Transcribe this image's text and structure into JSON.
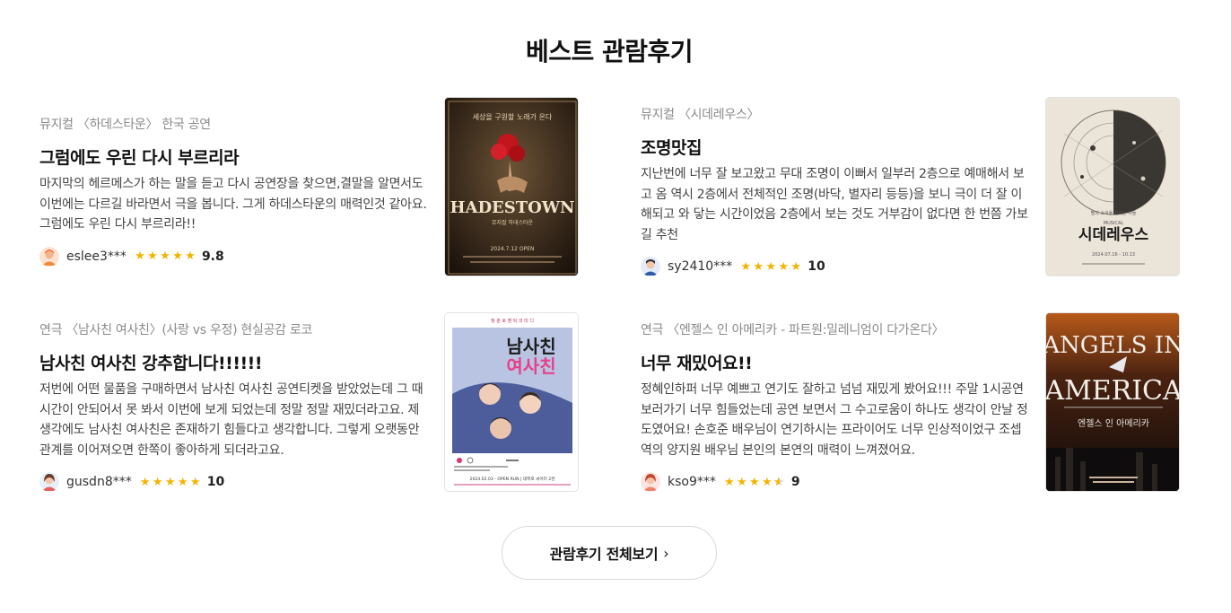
{
  "section": {
    "title": "베스트 관람후기"
  },
  "reviews": [
    {
      "category": "뮤지컬 〈하데스타운〉 한국 공연",
      "title": "그럼에도 우린 다시 부르리라",
      "body": "마지막의 헤르메스가 하는 말을 듣고 다시 공연장을 찾으면,결말을 알면서도 이번에는 다르길 바라면서 극을 봅니다. 그게 하데스타운의 매력인것 같아요. 그럼에도 우린 다시 부르리라!!",
      "user": "eslee3***",
      "rating": 9.8,
      "score": "9.8",
      "poster": {
        "top_text": "세상을 구원할 노래가 온다",
        "title": "HADESTOWN",
        "subtitle": "뮤지컬 하데스타운",
        "date": "2024.7.12 OPEN"
      }
    },
    {
      "category": "뮤지컬 〈시데레우스〉",
      "title": "조명맛집",
      "body": "지난번에 너무 잘 보고왔고 무대 조명이 이뻐서 일부러 2층으로 예매해서 보고 옴 역시 2층에서 전체적인 조명(바닥, 별자리 등등)을 보니 극이 더 잘 이해되고 와 닿는 시간이었음 2층에서 보는 것도 거부감이 없다면 한 번쯤 가보길 추천",
      "user": "sy2410***",
      "rating": 10,
      "score": "10",
      "poster": {
        "top_text": "별의 소식을 전하는 자들",
        "label": "MUSICAL",
        "title": "시데레우스",
        "date": "2024.07.16 - 10.13"
      }
    },
    {
      "category": "연극 〈남사친 여사친〉(사랑 vs 우정) 현실공감 로코",
      "title": "남사친 여사친 강추합니다!!!!!!",
      "body": "저번에 어떤 물품을 구매하면서 남사친 여사친 공연티켓을 받았었는데 그 때 시간이 안되어서 못 봐서 이번에 보게 되었는데 정말 정말 재밌더라고요. 제 생각에도 남사친 여사친은 존재하기 힘들다고 생각합니다. 그렇게 오랫동안 관계를 이어져오면 한쪽이 좋아하게 되더라고요.",
      "user": "gusdn8***",
      "rating": 10,
      "score": "10",
      "poster": {
        "top_text": "청 춘 로 맨 틱 코 미 디",
        "title_line1": "남사친",
        "title_line2": "여사친",
        "date": "2024.02.03 - OPEN RUN | 대학로 씨어터 2관"
      }
    },
    {
      "category": "연극 〈엔젤스 인 아메리카 - 파트원:밀레니엄이 다가온다〉",
      "title": "너무 재밌어요!!",
      "body": "정혜인하퍼 너무 예쁘고 연기도 잘하고 넘넘 재밌게 봤어요!!! 주말 1시공연 보러가기 너무 힘들었는데 공연 보면서 그 수고로움이 하나도 생각이 안날 정도였어요! 손호준 배우님이 연기하시는 프라이어도 너무 인상적이었구 조셉역의 양지원 배우님 본인의 본연의 매력이 느껴졌어요.",
      "user": "kso9***",
      "rating": 4.5,
      "score": "9",
      "poster": {
        "title_line1": "ANGELS IN",
        "title_line2": "AMERICA",
        "subtitle": "엔젤스 인 아메리카"
      }
    }
  ],
  "footer": {
    "all_button_label": "관람후기 전체보기"
  }
}
